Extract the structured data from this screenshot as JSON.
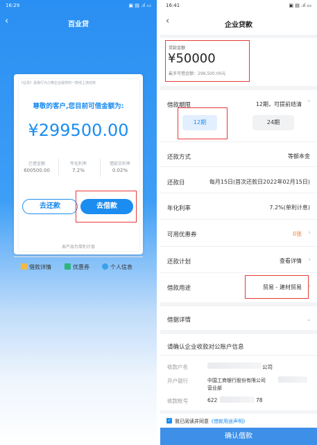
{
  "left": {
    "status_time": "16:29",
    "status_icons": "▣ ▤ .ıl ▭",
    "nav_title": "百业贷",
    "back_icon": "‹",
    "card": {
      "note": "《业贷》是我行为小微企业提供的一款线上流动资",
      "question": "尊敬的客户,您目前可借金额为:",
      "amount": "¥299500.00",
      "stats": [
        {
          "label": "已借金额",
          "value": "600500.00"
        },
        {
          "label": "年化利率",
          "value": "7.2%"
        },
        {
          "label": "借款日利率",
          "value": "0.02%"
        }
      ],
      "repay_label": "去还款",
      "borrow_label": "去借款",
      "footer": "本产品为单利计息"
    },
    "tabs": [
      "借款详情",
      "优惠券",
      "个人信息"
    ]
  },
  "right": {
    "status_time": "16:41",
    "status_icons": "▣ ▤ .ıl ▭",
    "nav_title": "企业贷款",
    "back_icon": "‹",
    "loan_amount_label": "贷款金额",
    "loan_amount": "¥50000",
    "max_amount": "最多可借金额：299,500.00元",
    "term_label": "借款期限",
    "term_value": "12期，可提前结清",
    "term_options": [
      "12期",
      "24期"
    ],
    "repay_method_label": "还款方式",
    "repay_method_value": "等额本金",
    "repay_day_label": "还款日",
    "repay_day_value": "每月15日(首次还款日2022年02月15日)",
    "rate_label": "年化利率",
    "rate_value": "7.2%(单利计息)",
    "coupon_label": "可用优惠券",
    "coupon_value": "0张",
    "plan_label": "还款计划",
    "plan_value": "查看详情",
    "purpose_label": "借款用途",
    "purpose_value": "贸易 - 建材贸易",
    "detail_label": "借据详情",
    "account_section_title": "请确认企业收款对公账户信息",
    "account_name_label": "收款户名",
    "account_name_value": "公司",
    "bank_label": "开户银行",
    "bank_value_line1": "中国工商银行股份有限公司",
    "bank_value_line2": "营业部",
    "account_no_label": "收款账号",
    "account_no_prefix": "622",
    "account_no_suffix": "78",
    "agree_text": "我已阅读并同意",
    "agree_link": "《借款用途声明》",
    "confirm_label": "确认借款"
  },
  "colors": {
    "primary": "#1b8cf0",
    "highlight_box": "#e53935",
    "coupon": "#f07a2a"
  }
}
